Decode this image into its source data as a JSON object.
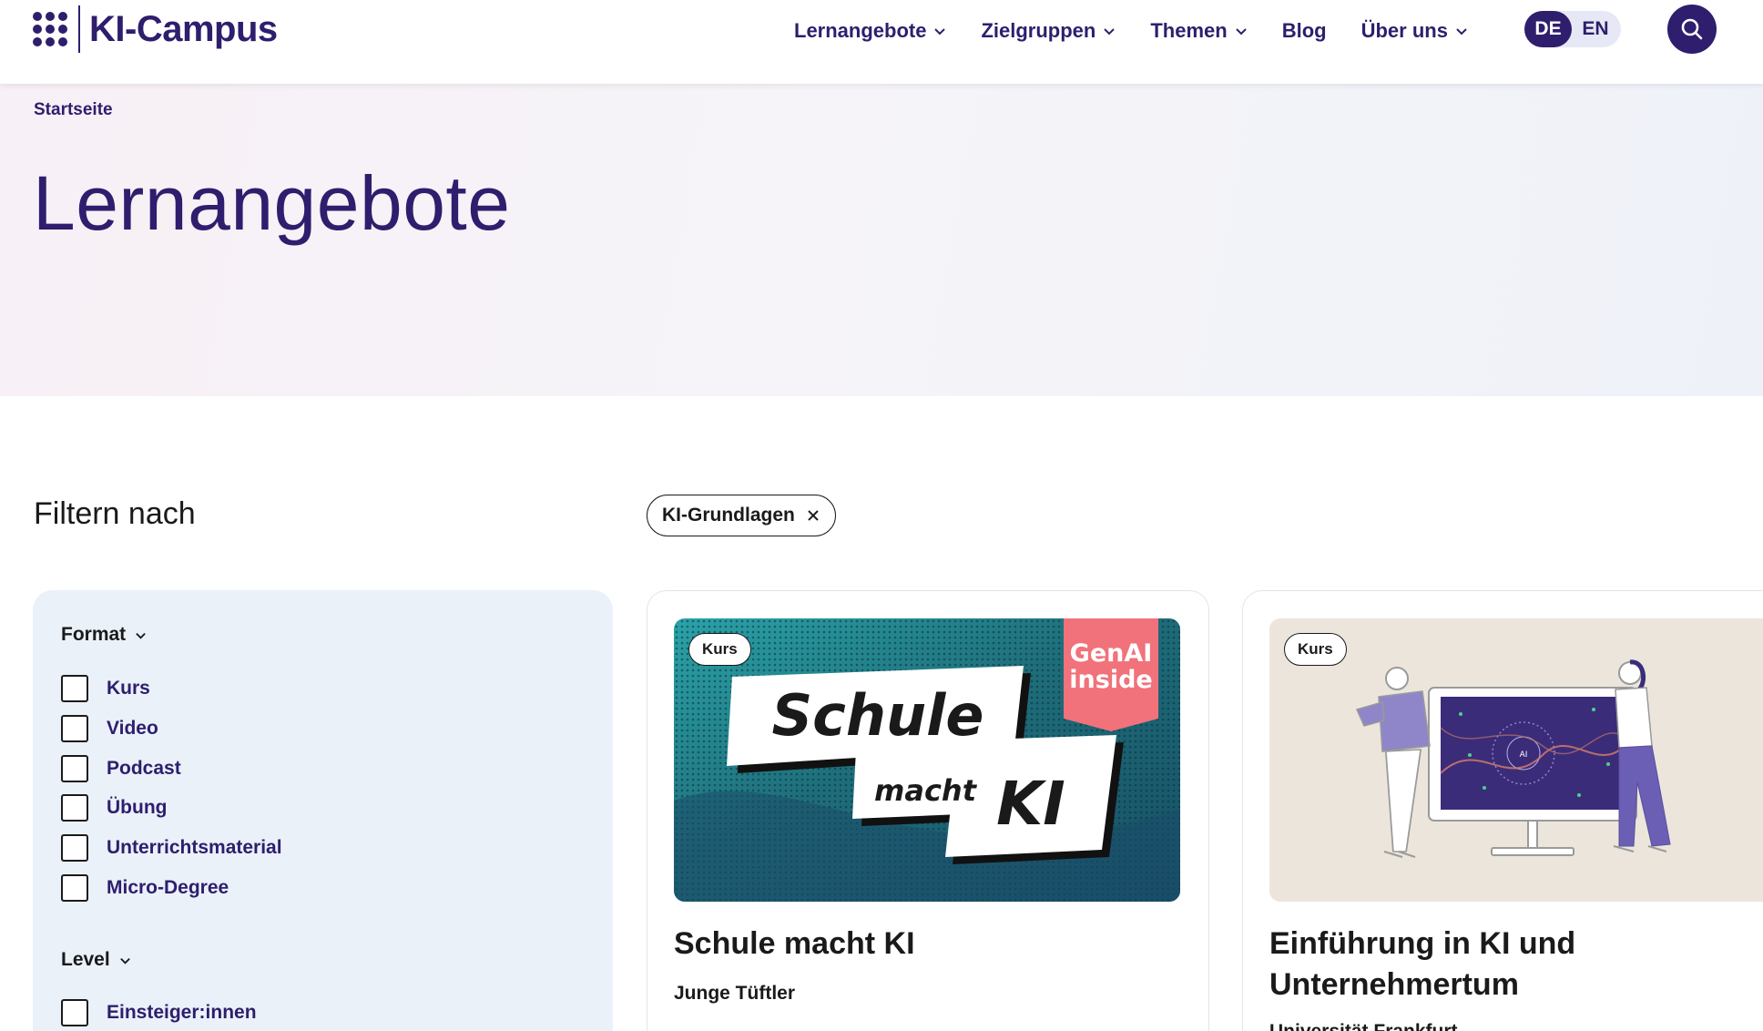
{
  "header": {
    "logo_text": "KI-Campus",
    "nav": [
      {
        "label": "Lernangebote",
        "has_menu": true
      },
      {
        "label": "Zielgruppen",
        "has_menu": true
      },
      {
        "label": "Themen",
        "has_menu": true
      },
      {
        "label": "Blog",
        "has_menu": false
      },
      {
        "label": "Über uns",
        "has_menu": true
      }
    ],
    "lang_active": "DE",
    "lang_other": "EN"
  },
  "hero": {
    "breadcrumb": "Startseite",
    "title": "Lernangebote"
  },
  "filters": {
    "heading": "Filtern nach",
    "active_chip": "KI-Grundlagen",
    "groups": [
      {
        "title": "Format",
        "options": [
          "Kurs",
          "Video",
          "Podcast",
          "Übung",
          "Unterrichtsmaterial",
          "Micro-Degree"
        ]
      },
      {
        "title": "Level",
        "options": [
          "Einsteiger:innen"
        ]
      }
    ]
  },
  "cards": [
    {
      "badge": "Kurs",
      "image_word_1": "Schule",
      "image_word_2": "macht",
      "image_word_3": "KI",
      "image_tag_1": "GenAI",
      "image_tag_2": "inside",
      "title": "Schule macht KI",
      "subtitle": "Junge Tüftler"
    },
    {
      "badge": "Kurs",
      "image_screen_text": "AI",
      "title": "Einführung in KI und Unternehmertum",
      "subtitle": "Universität Frankfurt"
    }
  ],
  "colors": {
    "brand": "#2e1e6d",
    "panel_bg": "#eaf1f9",
    "genai_tag": "#f1727a",
    "card1_bg": "#1e6e7a",
    "card2_bg": "#ebe5dc"
  }
}
